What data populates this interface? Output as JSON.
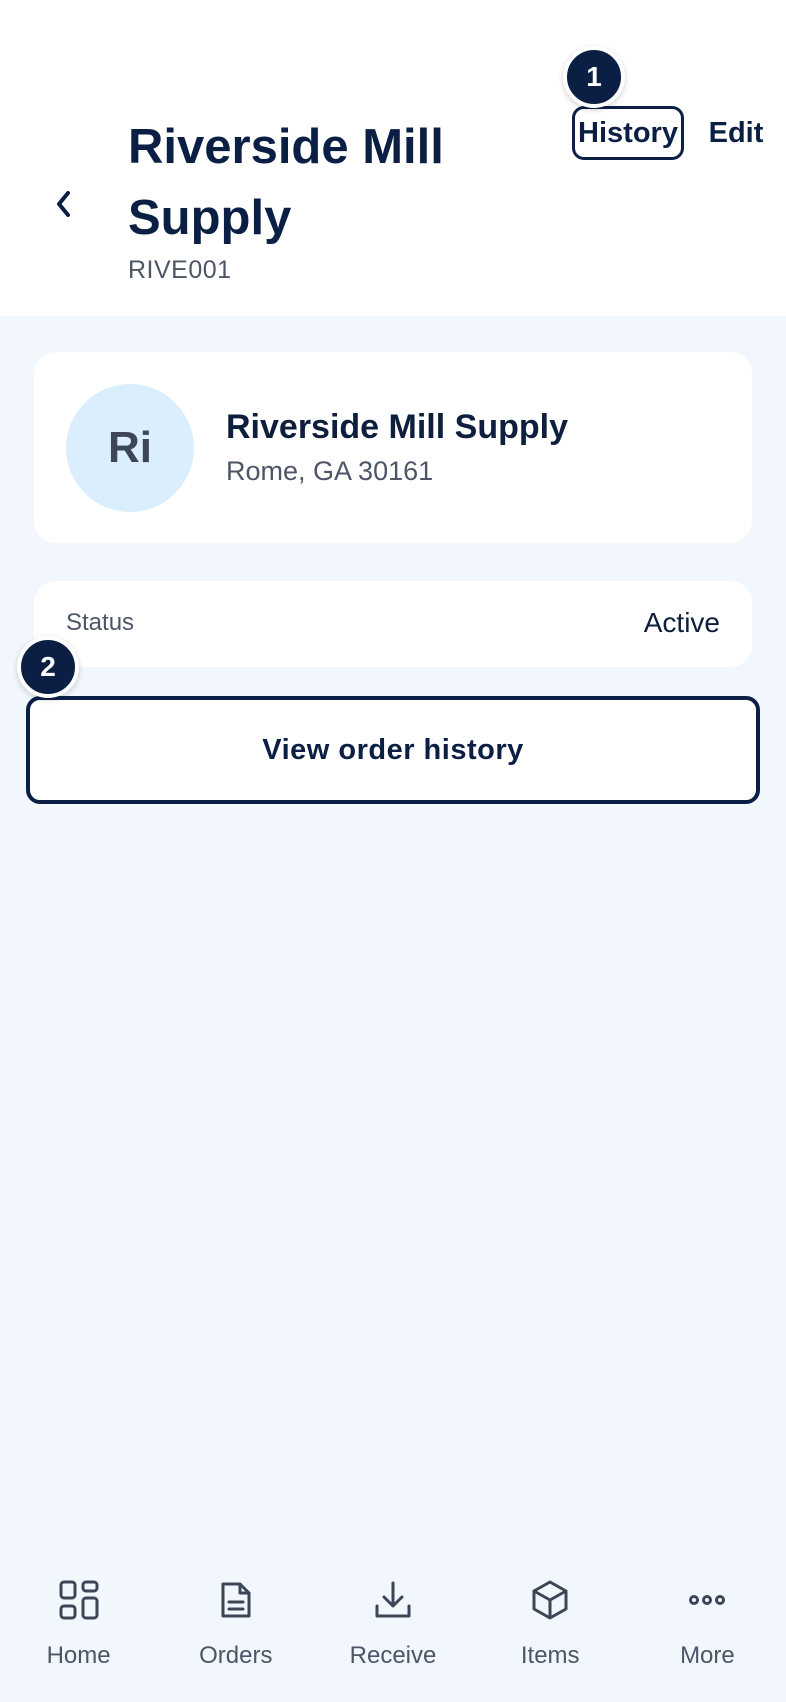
{
  "header": {
    "back_icon": "chevron-left-icon",
    "title": "Riverside Mill Supply",
    "code": "RIVE001",
    "history_label": "History",
    "edit_label": "Edit"
  },
  "markers": {
    "one": "1",
    "two": "2"
  },
  "profile": {
    "initials": "Ri",
    "name": "Riverside Mill Supply",
    "location": "Rome, GA 30161"
  },
  "status": {
    "label": "Status",
    "value": "Active"
  },
  "actions": {
    "view_order_history": "View order history"
  },
  "nav": {
    "items": [
      {
        "label": "Home",
        "icon": "grid-icon"
      },
      {
        "label": "Orders",
        "icon": "document-icon"
      },
      {
        "label": "Receive",
        "icon": "download-icon"
      },
      {
        "label": "Items",
        "icon": "box-icon"
      },
      {
        "label": "More",
        "icon": "ellipsis-icon"
      }
    ]
  },
  "colors": {
    "primary": "#0b1f45",
    "background": "#f1f7fd",
    "avatar_bg": "#dbeefd",
    "muted_text": "#4d5566"
  }
}
